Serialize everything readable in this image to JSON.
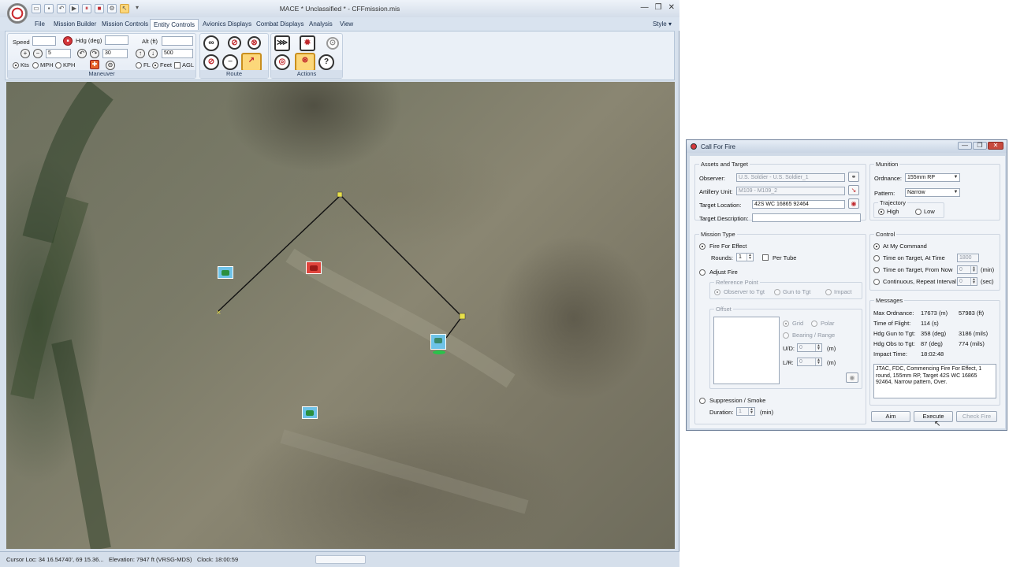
{
  "app": {
    "window_title": "MACE * Unclassified * - CFFmission.mis",
    "min_glyph": "—",
    "restore_glyph": "❐",
    "close_glyph": "✕"
  },
  "menu": {
    "items": [
      "File",
      "Mission Builder",
      "Mission Controls",
      "Entity Controls",
      "Avionics Displays",
      "Combat Displays",
      "Analysis",
      "View"
    ],
    "active": "Entity Controls",
    "style_label": "Style ▾"
  },
  "ribbon": {
    "maneuver": {
      "label": "Maneuver",
      "speed_label": "Speed",
      "hdg_label": "Hdg (deg)",
      "alt_label": "Alt (ft)",
      "step_speed": "5",
      "step_hdg": "30",
      "step_alt": "500",
      "unit_kts": "Kts",
      "unit_mph": "MPH",
      "unit_kph": "KPH",
      "alt_fl": "FL",
      "alt_feet": "Feet",
      "alt_agl": "AGL"
    },
    "route": {
      "label": "Route"
    },
    "actions": {
      "label": "Actions"
    }
  },
  "status": {
    "cursor": "Cursor Loc:   34 16.54740', 69 15.36...",
    "elevation": "Elevation:   7947 ft  (VRSG-MDS)",
    "clock": "Clock:    18:00:59"
  },
  "cff": {
    "title": "Call For Fire",
    "assets": {
      "legend": "Assets and Target",
      "observer_label": "Observer:",
      "observer_value": "U.S. Soldier - U.S. Soldier_1",
      "artillery_label": "Artillery Unit:",
      "artillery_value": "M109 - M109_2",
      "target_label": "Target Location:",
      "target_value": "42S WC 16865 92464",
      "desc_label": "Target Description:",
      "desc_value": ""
    },
    "munition": {
      "legend": "Munition",
      "ordnance_label": "Ordnance:",
      "ordnance_value": "155mm RP",
      "pattern_label": "Pattern:",
      "pattern_value": "Narrow",
      "trajectory_legend": "Trajectory",
      "traj_high": "High",
      "traj_low": "Low"
    },
    "mission_type": {
      "legend": "Mission Type",
      "ffe": "Fire For Effect",
      "rounds_label": "Rounds:",
      "rounds_value": "1",
      "per_tube": "Per Tube",
      "adjust": "Adjust Fire",
      "ref_point_legend": "Reference Point",
      "obs_to_tgt": "Observer to Tgt",
      "gun_to_tgt": "Gun to Tgt",
      "impact": "Impact",
      "offset_legend": "Offset",
      "grid": "Grid",
      "polar": "Polar",
      "bearing_range": "Bearing / Range",
      "ud_label": "U/D:",
      "ud_value": "0",
      "ud_unit": "(m)",
      "lr_label": "L/R:",
      "lr_value": "0",
      "lr_unit": "(m)",
      "suppression": "Suppression / Smoke",
      "duration_label": "Duration:",
      "duration_value": "1",
      "duration_unit": "(min)"
    },
    "control": {
      "legend": "Control",
      "at_my_command": "At My Command",
      "tot_at_time": "Time on Target, At Time",
      "tot_at_time_value": "1800",
      "tot_from_now": "Time on Target, From Now",
      "tot_from_now_value": "0",
      "tot_from_now_unit": "(min)",
      "continuous": "Continuous, Repeat Interval",
      "continuous_value": "0",
      "continuous_unit": "(sec)"
    },
    "messages": {
      "legend": "Messages",
      "rows": [
        {
          "label": "Max Ordnance:",
          "v1": "17673  (m)",
          "v2": "57983  (ft)"
        },
        {
          "label": "Time of Flight:",
          "v1": "114  (s)",
          "v2": ""
        },
        {
          "label": "Hdg Gun to Tgt:",
          "v1": "358  (deg)",
          "v2": "3186  (mils)"
        },
        {
          "label": "Hdg Obs to Tgt:",
          "v1": "87  (deg)",
          "v2": "774  (mils)"
        },
        {
          "label": "Impact Time:",
          "v1": "18:02:48",
          "v2": ""
        }
      ],
      "text": "JTAC, FDC, Commencing Fire For Effect, 1 round, 155mm RP, Target 42S WC 16865 92464, Narrow pattern, Over."
    },
    "buttons": {
      "aim": "Aim",
      "execute": "Execute",
      "check_fire": "Check Fire"
    }
  }
}
